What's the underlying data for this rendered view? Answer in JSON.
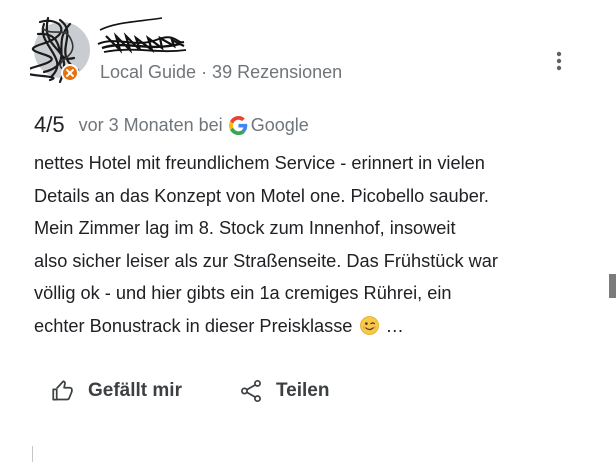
{
  "review": {
    "reviewer_meta": "Local Guide · 39 Rezensionen",
    "rating": "4/5",
    "time": "vor 3 Monaten bei",
    "source": "Google",
    "text_lines": [
      "nettes Hotel mit freundlichem Service - erinnert in vielen",
      "Details an das Konzept von Motel one. Picobello sauber.",
      "Mein Zimmer lag im 8. Stock zum Innenhof, insoweit",
      "also sicher leiser als zur Straßenseite. Das Frühstück war",
      "völlig ok - und hier gibts ein 1a cremiges Rührei, ein"
    ],
    "last_line": "echter Bonustrack in dieser Preisklasse",
    "ellipsis": "…"
  },
  "actions": {
    "like_label": "Gefällt mir",
    "share_label": "Teilen"
  },
  "icons": {
    "avatar": "avatar-scribbled",
    "badge": "local-guide-badge-icon",
    "more": "more-vertical-icon",
    "source_logo": "google-g-icon",
    "emoji": "winking-face-emoji",
    "like": "thumbs-up-icon",
    "share": "share-icon"
  },
  "colors": {
    "text": "#202124",
    "secondary": "#70757a",
    "badge": "#e8710a",
    "action": "#3c4043"
  }
}
